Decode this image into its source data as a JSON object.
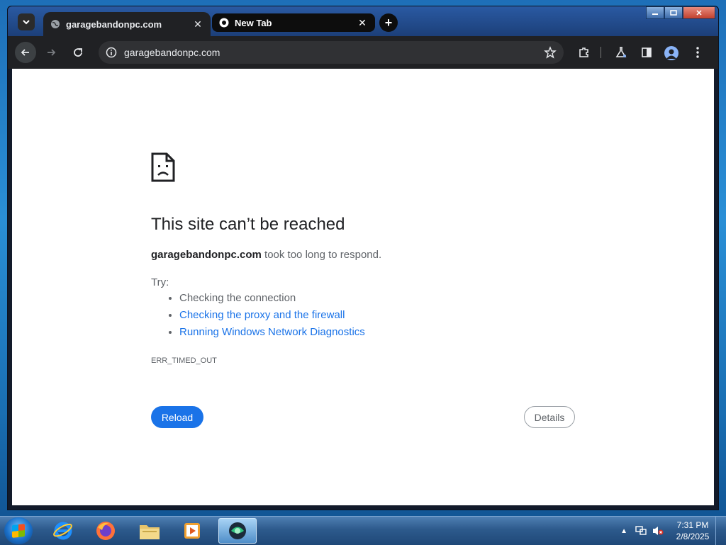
{
  "browser": {
    "tabs": [
      {
        "title": "garagebandonpc.com",
        "active": true
      },
      {
        "title": "New Tab",
        "active": false
      }
    ],
    "address_bar": {
      "url": "garagebandonpc.com"
    }
  },
  "error_page": {
    "title": "This site can’t be reached",
    "host": "garagebandonpc.com",
    "description_suffix": " took too long to respond.",
    "try_label": "Try:",
    "suggestions": [
      {
        "text": "Checking the connection",
        "link": false
      },
      {
        "text": "Checking the proxy and the firewall",
        "link": true
      },
      {
        "text": "Running Windows Network Diagnostics",
        "link": true
      }
    ],
    "error_code": "ERR_TIMED_OUT",
    "reload_label": "Reload",
    "details_label": "Details"
  },
  "taskbar": {
    "apps": [
      "internet-explorer",
      "firefox",
      "file-explorer",
      "media-player",
      "browser"
    ],
    "clock_time": "7:31 PM",
    "clock_date": "2/8/2025"
  },
  "colors": {
    "accent": "#1a73e8",
    "toolbar": "#202124"
  }
}
